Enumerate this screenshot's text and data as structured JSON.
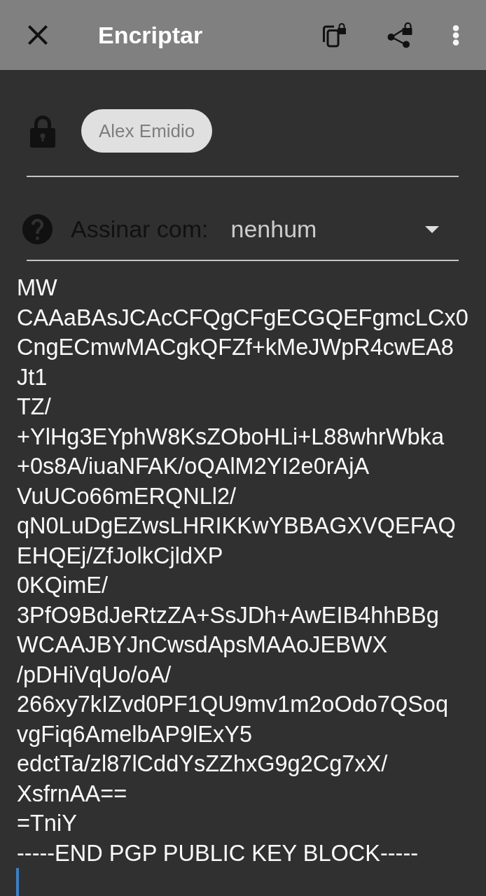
{
  "toolbar": {
    "title": "Encriptar"
  },
  "recipients": [
    {
      "name": "Alex Emidio"
    }
  ],
  "sign_with": {
    "label": "Assinar com:",
    "value": "nenhum"
  },
  "message": {
    "lines": [
      "MW",
      "CAAaBAsJCAcCFQgCFgECGQEFgmcLCx0",
      "CngECmwMACgkQFZf+kMeJWpR4cwEA8",
      "Jt1",
      "TZ/",
      "+YlHg3EYphW8KsZOboHLi+L88whrWbka",
      "+0s8A/iuaNFAK/oQAlM2YI2e0rAjA",
      "VuUCo66mERQNLl2/",
      "qN0LuDgEZwsLHRIKKwYBBAGXVQEFAQ",
      "EHQEj/ZfJolkCjldXP",
      "0KQimE/",
      "3PfO9BdJeRtzZA+SsJDh+AwEIB4hhBBg",
      "WCAAJBYJnCwsdApsMAAoJEBWX",
      "/pDHiVqUo/oA/",
      "266xy7kIZvd0PF1QU9mv1m2oOdo7QSoq",
      "vgFiq6AmelbAP9lExY5",
      "edctTa/zl87lCddYsZZhxG9g2Cg7xX/",
      "XsfrnAA==",
      "=TniY",
      "-----END PGP PUBLIC KEY BLOCK-----"
    ],
    "focused": true
  }
}
